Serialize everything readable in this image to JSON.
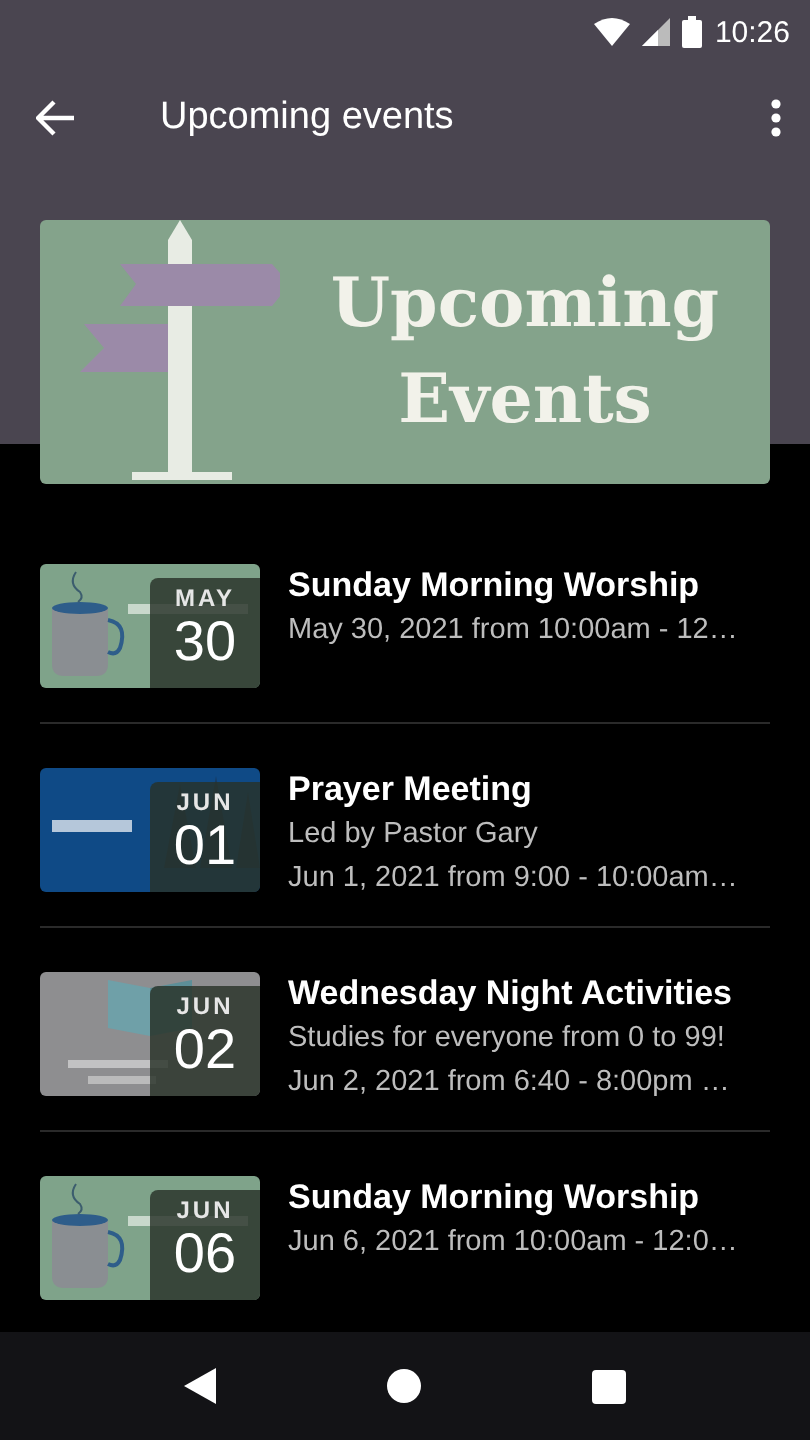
{
  "status_bar": {
    "time": "10:26"
  },
  "app_bar": {
    "title": "Upcoming events"
  },
  "banner": {
    "title_lines": [
      "Upcoming",
      "Events"
    ]
  },
  "events": [
    {
      "month": "MAY",
      "day": "30",
      "title": "Sunday Morning Worship",
      "lines": [
        "May 30, 2021 from 10:00am - 12…"
      ]
    },
    {
      "month": "JUN",
      "day": "01",
      "title": "Prayer Meeting",
      "lines": [
        "Led by Pastor Gary",
        "Jun 1, 2021 from 9:00 - 10:00am…"
      ]
    },
    {
      "month": "JUN",
      "day": "02",
      "title": "Wednesday Night Activities",
      "lines": [
        "Studies for everyone from 0 to 99!",
        "Jun 2, 2021 from 6:40 - 8:00pm …"
      ]
    },
    {
      "month": "JUN",
      "day": "06",
      "title": "Sunday Morning Worship",
      "lines": [
        "Jun 6, 2021 from 10:00am - 12:0…"
      ]
    }
  ]
}
